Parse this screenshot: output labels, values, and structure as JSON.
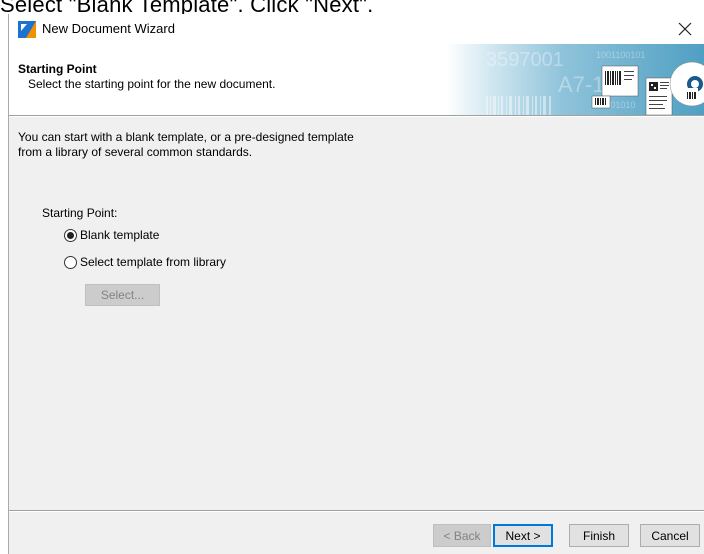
{
  "instruction": "Select \"Blank Template\". Click \"Next\".",
  "window": {
    "title": "New Document Wizard",
    "close_glyph": "✕"
  },
  "header": {
    "title": "Starting Point",
    "subtitle": "Select the starting point for the new document."
  },
  "body": {
    "intro_line1": "You can start with a blank template, or a pre-designed template",
    "intro_line2": "from a library of several common standards.",
    "starting_point_label": "Starting Point:",
    "options": [
      {
        "label": "Blank template",
        "checked": true
      },
      {
        "label": "Select template from library",
        "checked": false
      }
    ],
    "select_button": "Select..."
  },
  "footer": {
    "back": "< Back",
    "next": "Next >",
    "finish": "Finish",
    "cancel": "Cancel"
  },
  "colors": {
    "accent": "#0078d7",
    "icon_blue": "#1a73d0",
    "icon_orange": "#f29100",
    "banner_blue": "#5fa8c8"
  }
}
